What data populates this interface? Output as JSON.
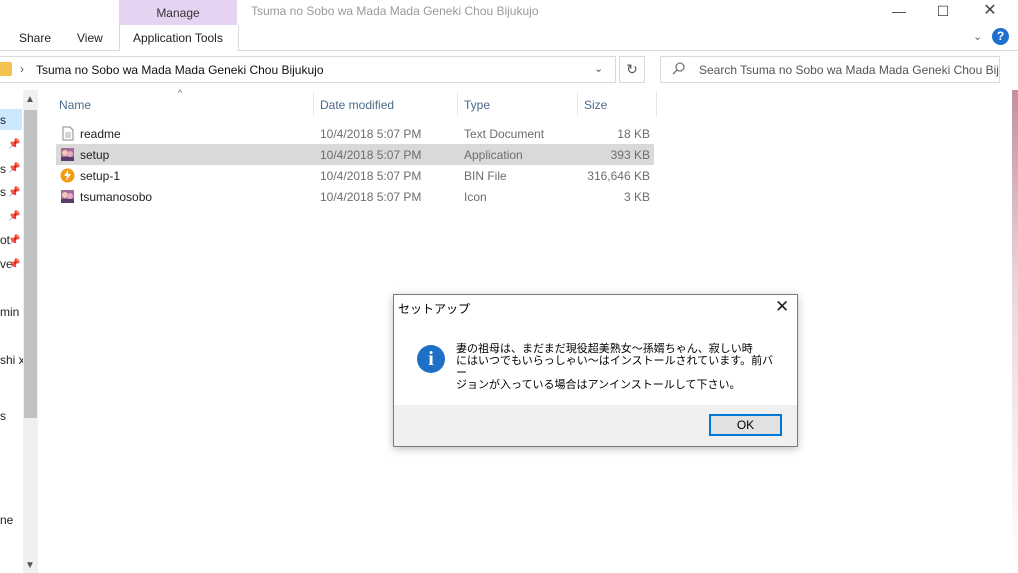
{
  "titlebar": {
    "manage_tab": "Manage",
    "window_title": "Tsuma no Sobo wa Mada Mada Geneki Chou Bijukujo",
    "minimize": "—",
    "maximize": "☐",
    "close": "✕"
  },
  "ribbon": {
    "tabs": [
      "Share",
      "View",
      "Application Tools"
    ],
    "help": "?",
    "expand": "⌄"
  },
  "address": {
    "separator": "›",
    "path": "Tsuma no Sobo wa Mada Mada Geneki Chou Bijukujo",
    "dropdown": "⌄",
    "refresh": "↻"
  },
  "search": {
    "placeholder": "Search Tsuma no Sobo wa Mada Mada Geneki Chou Bij..."
  },
  "nav_pane": {
    "items": [
      "s",
      "s",
      "s",
      "",
      "ot",
      "ve",
      "min",
      "shi x",
      "s",
      "ne"
    ],
    "up": "▲",
    "down": "▼"
  },
  "file_list": {
    "columns": [
      "Name",
      "Date modified",
      "Type",
      "Size"
    ],
    "sort_arrow": "^",
    "rows": [
      {
        "name": "readme",
        "date": "10/4/2018 5:07 PM",
        "type": "Text Document",
        "size": "18 KB",
        "icon": "text-document-icon"
      },
      {
        "name": "setup",
        "date": "10/4/2018 5:07 PM",
        "type": "Application",
        "size": "393 KB",
        "icon": "application-icon"
      },
      {
        "name": "setup-1",
        "date": "10/4/2018 5:07 PM",
        "type": "BIN File",
        "size": "316,646 KB",
        "icon": "bin-file-icon"
      },
      {
        "name": "tsumanosobo",
        "date": "10/4/2018 5:07 PM",
        "type": "Icon",
        "size": "3 KB",
        "icon": "icon-file-icon"
      }
    ]
  },
  "dialog": {
    "title": "セットアップ",
    "close": "✕",
    "icon": "i",
    "message": "妻の祖母は、まだまだ現役超美熟女～孫婿ちゃん、寂しい時\nにはいつでもいらっしゃい～はインストールされています。前バー\nジョンが入っている場合はアンインストールして下さい。",
    "ok_label": "OK"
  },
  "colors": {
    "manage_tab": "#e6d3f2",
    "selection": "#d9d9d9",
    "accent": "#0078d7",
    "info_icon": "#1e6fc6"
  }
}
